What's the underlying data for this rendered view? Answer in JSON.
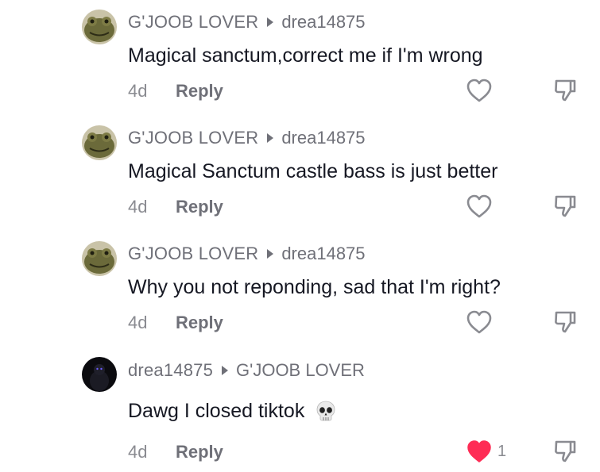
{
  "comments": [
    {
      "author": "G'JOOB LOVER",
      "reply_to": "drea14875",
      "text": "Magical sanctum,correct me if I'm wrong",
      "time": "4d",
      "reply_label": "Reply",
      "liked": false,
      "like_count": "",
      "avatar": "frog-avatar"
    },
    {
      "author": "G'JOOB LOVER",
      "reply_to": "drea14875",
      "text": "Magical Sanctum castle bass is just better",
      "time": "4d",
      "reply_label": "Reply",
      "liked": false,
      "like_count": "",
      "avatar": "frog-avatar"
    },
    {
      "author": "G'JOOB LOVER",
      "reply_to": "drea14875",
      "text": "Why you not reponding, sad that I'm right?",
      "time": "4d",
      "reply_label": "Reply",
      "liked": false,
      "like_count": "",
      "avatar": "frog-avatar"
    },
    {
      "author": "drea14875",
      "reply_to": "G'JOOB LOVER",
      "text": "Dawg I closed tiktok",
      "emoji": "skull-emoji",
      "time": "4d",
      "reply_label": "Reply",
      "liked": true,
      "like_count": "1",
      "avatar": "dark-avatar"
    }
  ],
  "colors": {
    "text": "#161823",
    "secondary": "#6f7078",
    "muted": "#8a8b91",
    "like_active": "#fe2c55",
    "icon": "#8a8b91"
  }
}
